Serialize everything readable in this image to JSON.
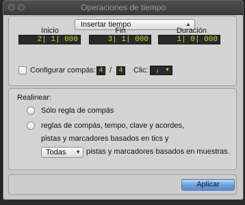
{
  "window": {
    "title": "Operaciones de tiempo"
  },
  "operation": {
    "selected": "Insertar tiempo"
  },
  "columns": [
    {
      "label": "Inicio",
      "value": "2| 1| 000"
    },
    {
      "label": "Fin",
      "value": "3| 1| 000"
    },
    {
      "label": "Duración",
      "value": "1| 0| 000"
    }
  ],
  "meter": {
    "checkbox_label": "Configurar compás:",
    "numerator": "4",
    "separator": "/",
    "denominator": "4",
    "click_label": "Clic:",
    "click_note": "♩"
  },
  "realign": {
    "heading": "Realinear:",
    "option1": "Sólo regla de compás",
    "option2_line1": "reglas de compás, tempo, clave y acordes,",
    "option2_line2": "pistas y marcadores basados en tics y",
    "option2_dropdown": "Todas",
    "option2_line3": "pistas y marcadores basados en muestras."
  },
  "footer": {
    "apply_label": "Aplicar"
  }
}
